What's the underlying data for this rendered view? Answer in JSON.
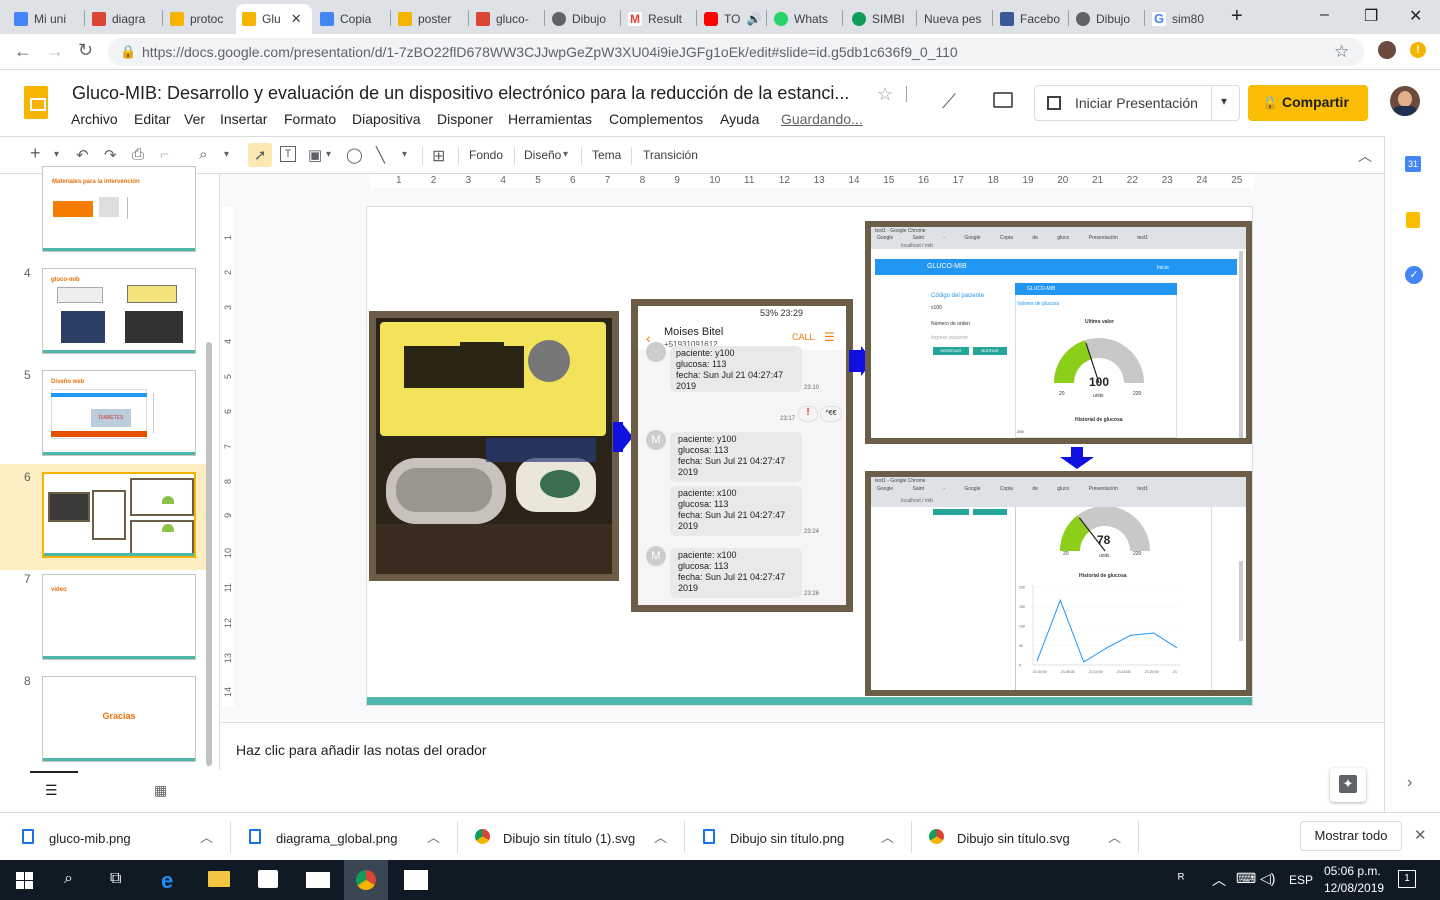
{
  "browser": {
    "tabs": [
      {
        "label": "Mi uni",
        "color": "#4285f4"
      },
      {
        "label": "diagra",
        "color": "#db4437"
      },
      {
        "label": "protoc",
        "color": "#f4b400"
      },
      {
        "label": "Glu",
        "color": "#f4b400"
      },
      {
        "label": "Copia",
        "color": "#4285f4"
      },
      {
        "label": "poster",
        "color": "#f4b400"
      },
      {
        "label": "gluco-",
        "color": "#db4437"
      },
      {
        "label": "Dibujo",
        "color": "#5f6368"
      },
      {
        "label": "Result",
        "color": "#db4437"
      },
      {
        "label": "TO",
        "color": "#ff0000"
      },
      {
        "label": "Whats",
        "color": "#25d366"
      },
      {
        "label": "SIMBI",
        "color": "#0f9d58"
      },
      {
        "label": "Nueva pes",
        "color": "#ffffff"
      },
      {
        "label": "Facebo",
        "color": "#3b5998"
      },
      {
        "label": "Dibujo",
        "color": "#5f6368"
      },
      {
        "label": "sim80",
        "color": "#4285f4"
      }
    ],
    "url": "https://docs.google.com/presentation/d/1-7zBO22flD678WW3CJJwpGeZpW3XU04i9ieJGFg1oEk/edit#slide=id.g5db1c636f9_0_110",
    "min_icon": "–",
    "max_icon": "❐",
    "close_icon": "✕",
    "new_tab_icon": "+"
  },
  "docs": {
    "title": "Gluco-MIB: Desarrollo y evaluación de un dispositivo electrónico para la reducción de la estanci...",
    "menu": [
      "Archivo",
      "Editar",
      "Ver",
      "Insertar",
      "Formato",
      "Diapositiva",
      "Disponer",
      "Herramientas",
      "Complementos",
      "Ayuda"
    ],
    "saving": "Guardando...",
    "present_label": "Iniciar Presentación",
    "share_label": "Compartir"
  },
  "toolbar": {
    "fondo": "Fondo",
    "diseno": "Diseño",
    "tema": "Tema",
    "transicion": "Transición"
  },
  "ruler": {
    "h": [
      "1",
      "2",
      "3",
      "4",
      "5",
      "6",
      "7",
      "8",
      "9",
      "10",
      "11",
      "12",
      "13",
      "14",
      "15",
      "16",
      "17",
      "18",
      "19",
      "20",
      "21",
      "22",
      "23",
      "24",
      "25"
    ],
    "v": [
      "1",
      "2",
      "3",
      "4",
      "5",
      "6",
      "7",
      "8",
      "9",
      "10",
      "11",
      "12",
      "13",
      "14"
    ]
  },
  "filmstrip": {
    "slides": [
      {
        "num": "",
        "title": "Materiales para la intervención"
      },
      {
        "num": "4",
        "title": "gluco-mib"
      },
      {
        "num": "5",
        "title": "Diseño web"
      },
      {
        "num": "6",
        "title": ""
      },
      {
        "num": "7",
        "title": "video"
      },
      {
        "num": "8",
        "title": "Gracias"
      }
    ],
    "slide5_banner": "DIABETES"
  },
  "phone": {
    "status": "53% 23:29",
    "contact": "Moises Bitel",
    "number": "+51931091612",
    "call": "CALL",
    "msg0": "paciente: y100",
    "msg0_lines": [
      "glucosa: 113",
      "fecha: Sun Jul 21 04:27:47",
      "2019"
    ],
    "msg0_time": "23:10",
    "mid_time": "23:17",
    "mid_badge": "^€€",
    "msgs": [
      {
        "lines": [
          "paciente: y100",
          "glucosa: 113",
          "fecha: Sun Jul 21 04:27:47",
          "2019"
        ],
        "time": ""
      },
      {
        "lines": [
          "paciente: x100",
          "glucosa: 113",
          "fecha: Sun Jul 21 04:27:47",
          "2019"
        ],
        "time": "23:24"
      },
      {
        "lines": [
          "paciente: x100",
          "glucosa: 113",
          "fecha: Sun Jul 21 04:27:47",
          "2019"
        ],
        "time": "23:26"
      }
    ]
  },
  "web1": {
    "browser_title": "test1 - Google Chrome",
    "tab_labels": [
      "Google",
      "Saint - Google",
      "Copia de gluco",
      "Presentación",
      "Presentación",
      "WhatsApp",
      "test1",
      "Guide tl M"
    ],
    "host": "localhost / mib",
    "banner": "GLUCO-MIB",
    "banner_right": "Inicio",
    "codigo": "Código del paciente",
    "codigo_val": "x100",
    "orden": "Número de orden",
    "orden2": "Ingrese paciente",
    "btn1": "INGRESAR",
    "btn2": "BORRAR",
    "panel_title": "GLUCO-MIB",
    "panel_sub": "Valores de glucosa",
    "ultimo": "Ultimo valor",
    "gauge_val": "100",
    "gauge_min": "20",
    "gauge_max": "220",
    "gauge_unit": "units",
    "hist": "Historial de glucosa",
    "axis0": "200"
  },
  "web2": {
    "browser_title": "test1 - Google Chrome",
    "tab_labels": [
      "Google",
      "Saint - Google",
      "Copia de gluco",
      "Presentación",
      "Presentación",
      "WhatsApp",
      "test1",
      "Guide tl M"
    ],
    "host": "localhost / mib",
    "gauge_val": "78",
    "gauge_min": "20",
    "gauge_max": "220",
    "gauge_unit": "units",
    "hist": "Historial de glucosa",
    "y_ticks": [
      "200",
      "150",
      "100",
      "50",
      "0"
    ],
    "x_ticks": [
      "21:00:00",
      "21:05:00",
      "21:10:00",
      "21:15:00",
      "21:20:00",
      "21"
    ],
    "series": [
      0.05,
      0.83,
      0.04,
      0.22,
      0.38,
      0.41,
      0.22
    ]
  },
  "notes": {
    "placeholder": "Haz clic para añadir las notas del orador"
  },
  "downloads": {
    "items": [
      "gluco-mib.png",
      "diagrama_global.png",
      "Dibujo sin título (1).svg",
      "Dibujo sin título.png",
      "Dibujo sin título.svg"
    ],
    "show_all": "Mostrar todo"
  },
  "taskbar": {
    "lang": "ESP",
    "time": "05:06 p.m.",
    "date": "12/08/2019",
    "notif": "1"
  }
}
